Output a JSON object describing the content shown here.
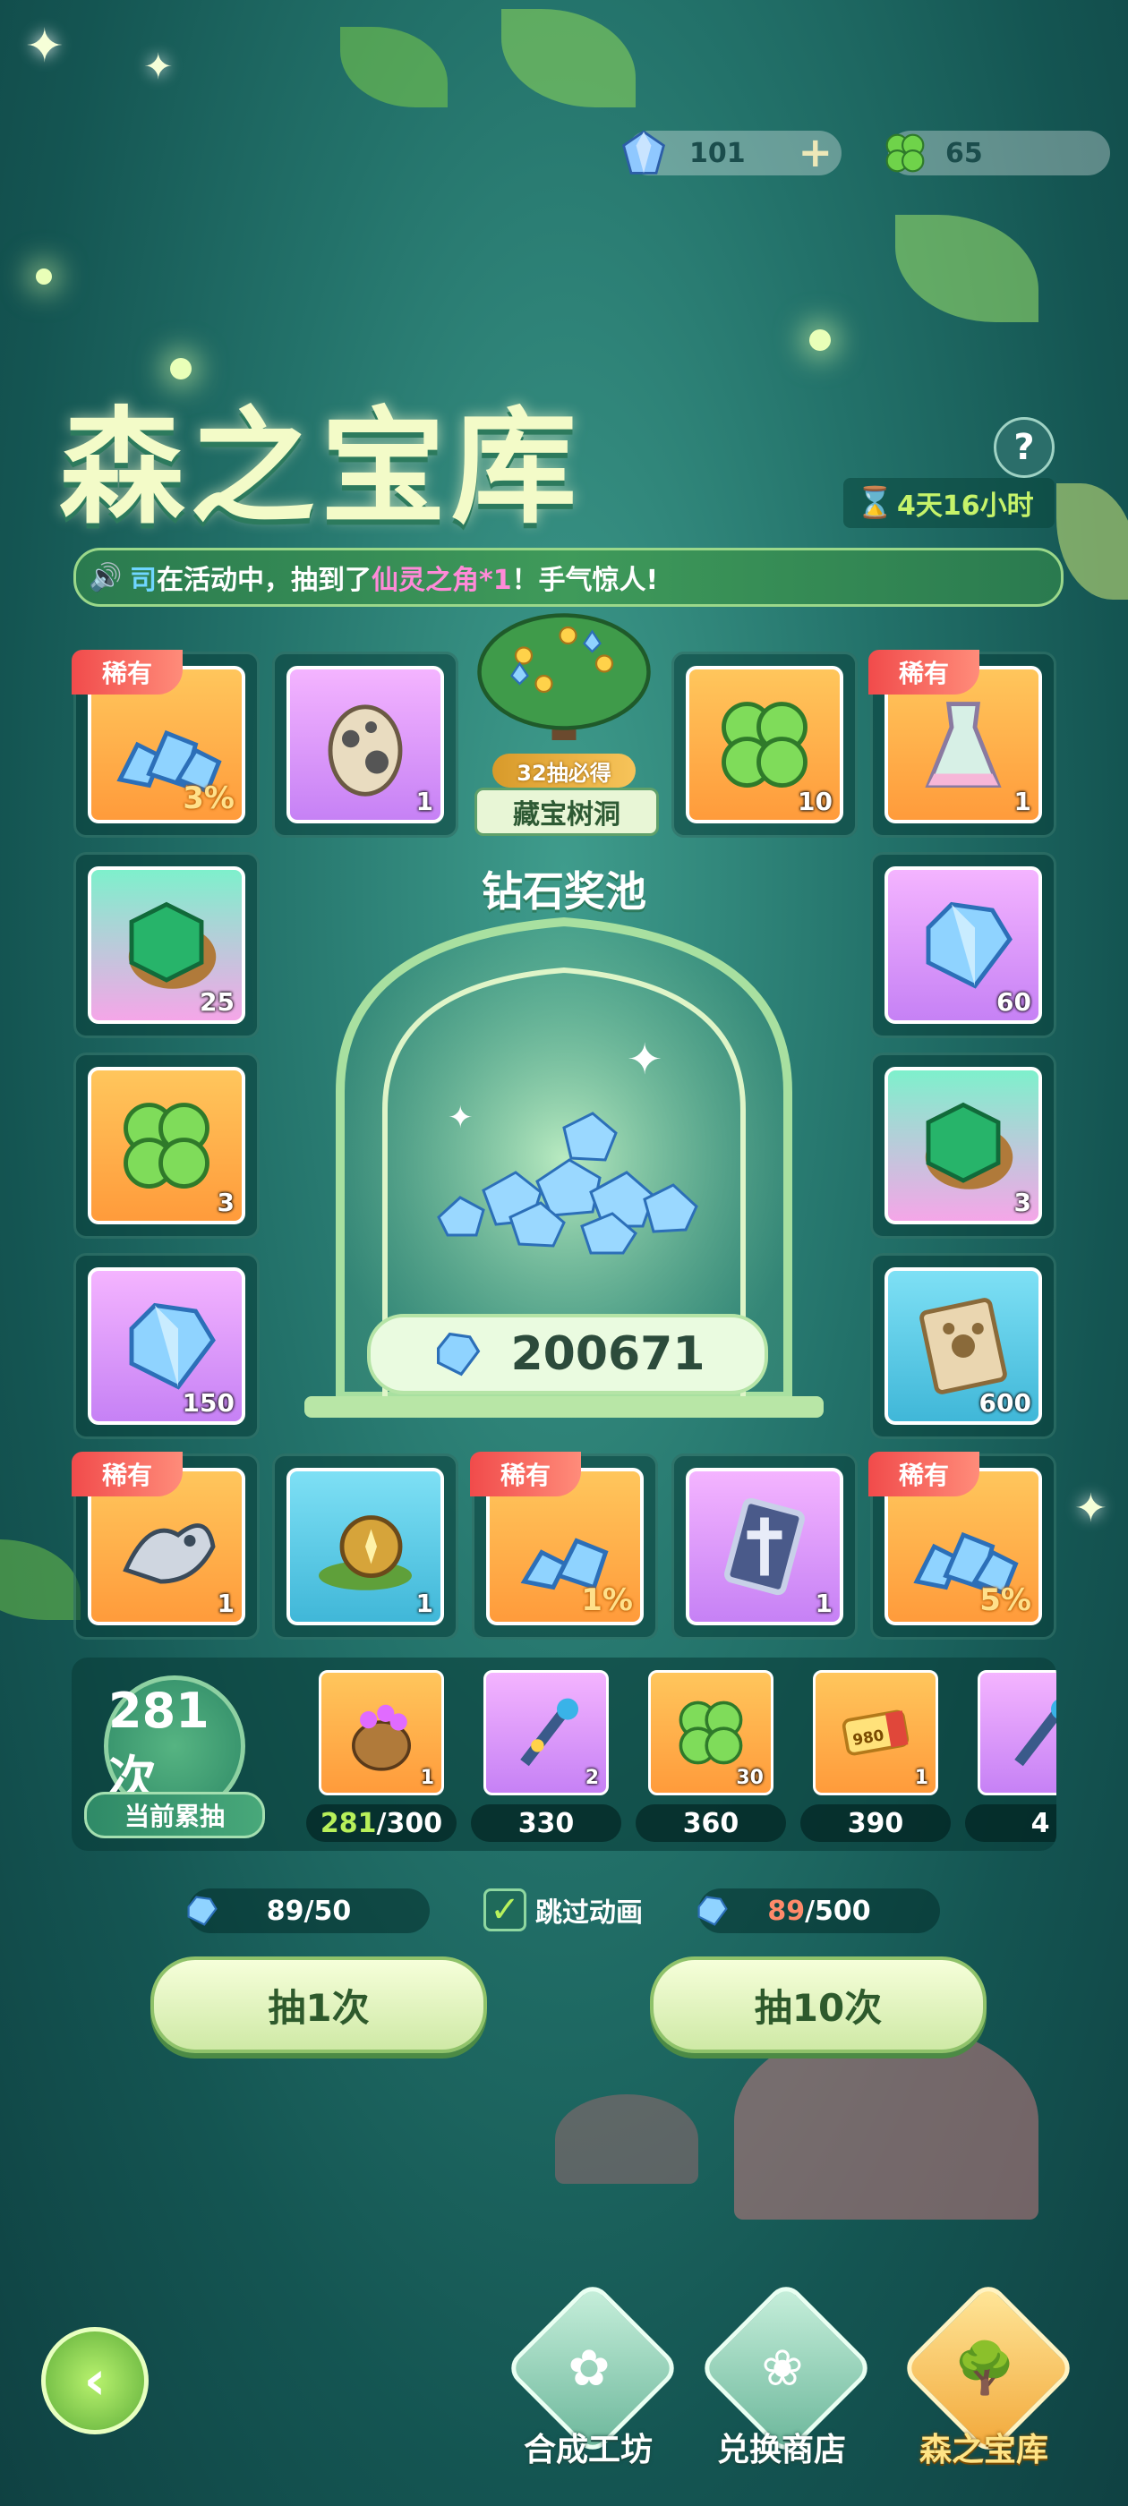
{
  "currency": {
    "gems": "101",
    "clover": "65",
    "plus": "+"
  },
  "title": "森之宝库",
  "help": "?",
  "timer": "4天16小时",
  "ticker": {
    "name": "司",
    "pre": "在活动中，抽到了",
    "item": "仙灵之角*1",
    "post": "！手气惊人!"
  },
  "rare_label": "稀有",
  "items": {
    "r1c1": "3%",
    "r1c2": "1",
    "r1c4": "10",
    "r1c5": "1",
    "r2c1": "25",
    "r2c5": "60",
    "r3c1": "3",
    "r3c5": "3",
    "r4c1": "150",
    "r4c5": "600",
    "r5c1": "1",
    "r5c2": "1",
    "r5c3": "1%",
    "r5c4": "1",
    "r5c5": "5%"
  },
  "tree": {
    "must": "32抽必得",
    "name": "藏宝树洞"
  },
  "pool": {
    "title": "钻石奖池",
    "count": "200671"
  },
  "progress": {
    "count": "281次",
    "label": "当前累抽"
  },
  "milestones": [
    {
      "qty": "1",
      "current": "281",
      "target": "/300"
    },
    {
      "qty": "2",
      "target": "330"
    },
    {
      "qty": "30",
      "target": "360"
    },
    {
      "qty": "1",
      "target": "390",
      "ticket": "980"
    },
    {
      "target": "4"
    }
  ],
  "costs": {
    "single": "89/50",
    "ten_have": "89",
    "ten_need": "/500"
  },
  "skip": "跳过动画",
  "buttons": {
    "draw1": "抽1次",
    "draw10": "抽10次"
  },
  "tabs": {
    "craft": "合成工坊",
    "shop": "兑换商店",
    "vault": "森之宝库"
  },
  "colors": {
    "accent": "#b8f05a",
    "rare": "#f14b4b",
    "title": "#f3fbc8"
  }
}
